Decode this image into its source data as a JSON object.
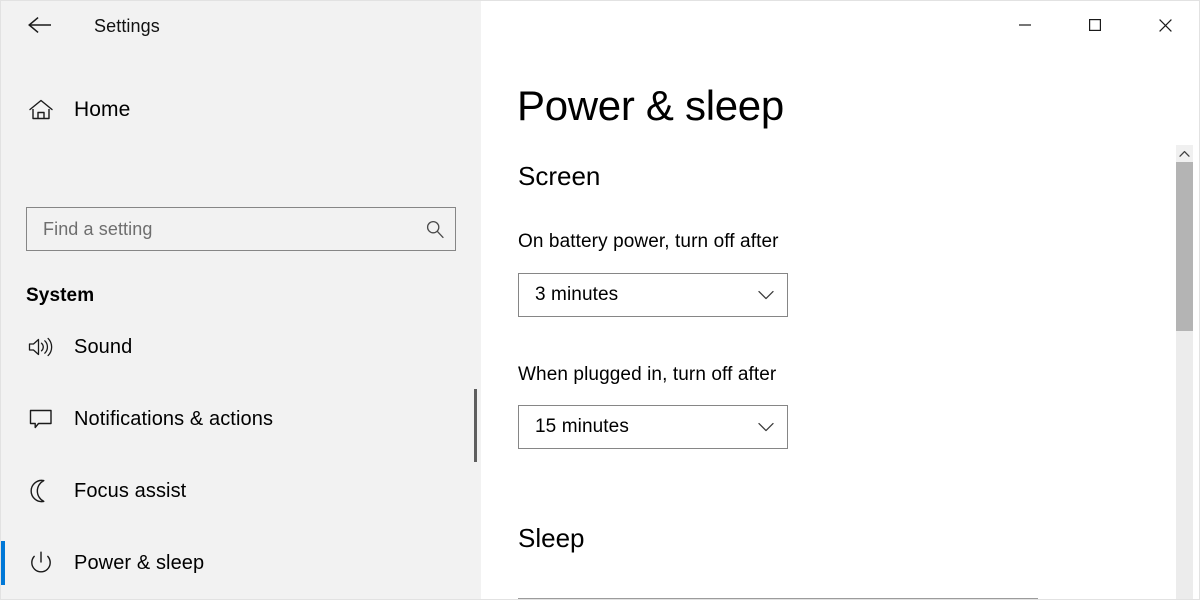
{
  "window": {
    "title": "Settings",
    "back_icon": "back-arrow-icon",
    "controls": {
      "minimize": "minimize-icon",
      "maximize": "maximize-icon",
      "close": "close-icon"
    }
  },
  "sidebar": {
    "home": {
      "label": "Home",
      "icon": "home-icon"
    },
    "search": {
      "placeholder": "Find a setting",
      "icon": "search-icon"
    },
    "group_header": "System",
    "items": [
      {
        "label": "Sound",
        "icon": "speaker-icon",
        "selected": false
      },
      {
        "label": "Notifications & actions",
        "icon": "speech-bubble-icon",
        "selected": false
      },
      {
        "label": "Focus assist",
        "icon": "moon-icon",
        "selected": false
      },
      {
        "label": "Power & sleep",
        "icon": "power-icon",
        "selected": true
      }
    ],
    "accent_color": "#0078d7",
    "background_color": "#f2f2f2"
  },
  "main": {
    "page_title": "Power & sleep",
    "sections": [
      {
        "heading": "Screen",
        "fields": [
          {
            "label": "On battery power, turn off after",
            "value": "3 minutes",
            "arrow_icon": "chevron-down-icon"
          },
          {
            "label": "When plugged in, turn off after",
            "value": "15 minutes",
            "arrow_icon": "chevron-down-icon"
          }
        ]
      },
      {
        "heading": "Sleep",
        "fields": []
      }
    ]
  },
  "scrollbar": {
    "up_arrow_icon": "chevron-up-icon",
    "thumb_color": "#b4b4b4",
    "track_color": "#ececec"
  }
}
